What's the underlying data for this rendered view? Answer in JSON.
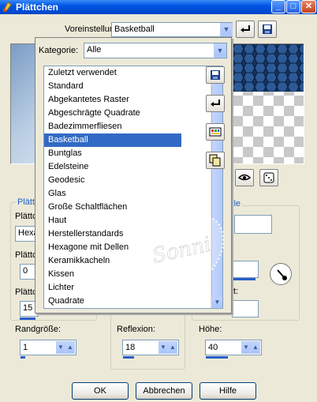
{
  "window": {
    "title": "Plättchen"
  },
  "presets": {
    "label": "Voreinstellungen:",
    "value": "Basketball"
  },
  "category": {
    "label": "Kategorie:",
    "value": "Alle"
  },
  "list": {
    "items": [
      "Zuletzt verwendet",
      "Standard",
      "Abgekantetes Raster",
      "Abgeschrägte Quadrate",
      "Badezimmerfliesen",
      "Basketball",
      "Buntglas",
      "Edelsteine",
      "Geodesic",
      "Glas",
      "Große Schaltflächen",
      "Haut",
      "Herstellerstandards",
      "Hexagone mit Dellen",
      "Keramikkacheln",
      "Kissen",
      "Lichter",
      "Quadrate"
    ],
    "selected": "Basketball"
  },
  "left_group": {
    "title": "Plätt",
    "label1": "Plättc",
    "value1": "Hexa",
    "label2": "Plättc",
    "value2": "0",
    "label3": "Plättc",
    "value3": "15"
  },
  "right_group": {
    "title_fragment": "lle",
    "label_fragment": "t:"
  },
  "bottom": {
    "border_size": {
      "label": "Randgröße:",
      "value": "1"
    },
    "reflection": {
      "label": "Reflexion:",
      "value": "18"
    },
    "height": {
      "label": "Höhe:",
      "value": "40"
    }
  },
  "buttons": {
    "ok": "OK",
    "cancel": "Abbrechen",
    "help": "Hilfe"
  },
  "watermark": {
    "text": "Sonni"
  },
  "colors": {
    "selection": "#316ac5",
    "titlebar": "#0054e3",
    "hex_preview": "#1c3d6e"
  }
}
